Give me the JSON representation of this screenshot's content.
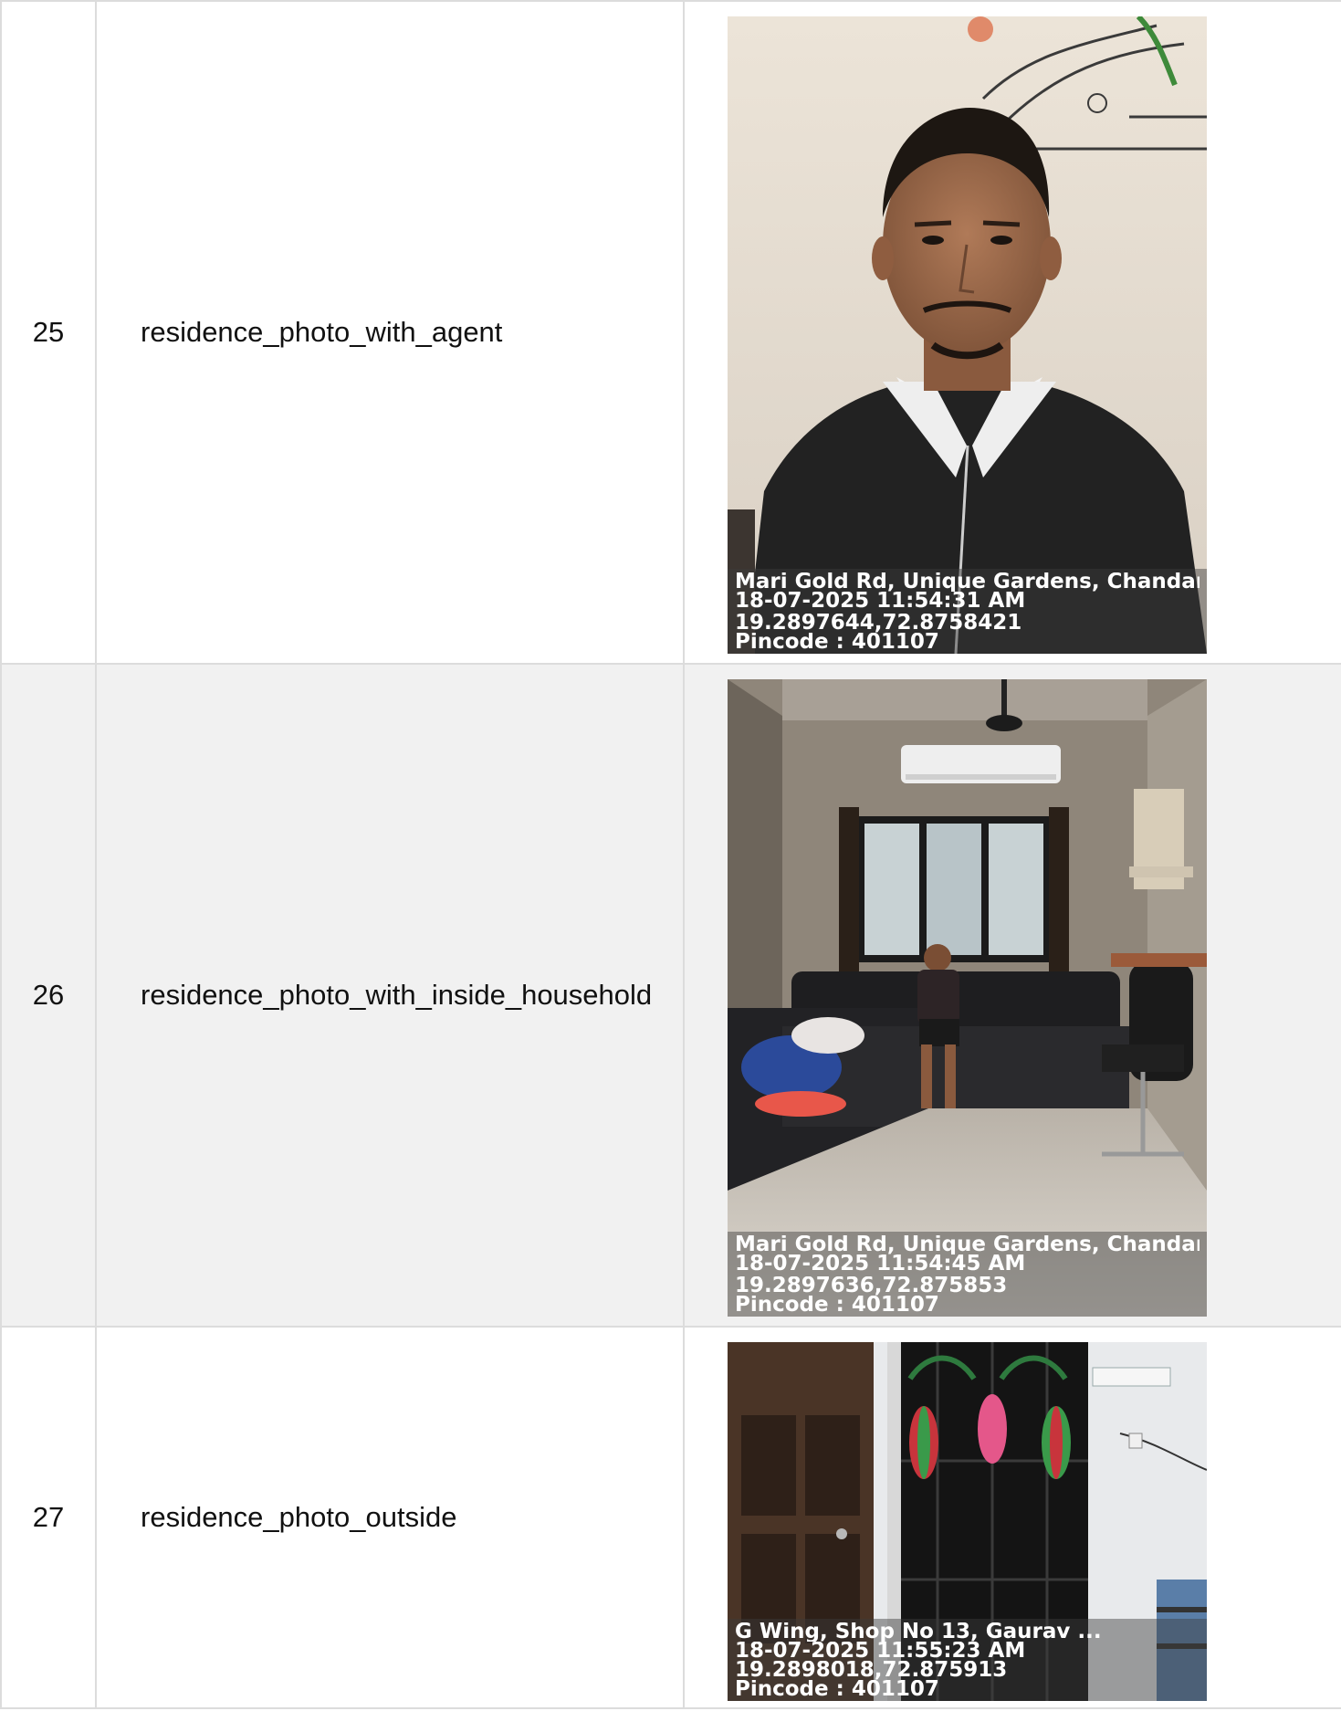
{
  "rows": [
    {
      "number": "25",
      "label": "residence_photo_with_agent",
      "photo": {
        "subject": "selfie of agent wearing black jacket with white collar",
        "stamp": {
          "address": "Mari Gold Rd, Unique Gardens, Chandan ...",
          "datetime": "18-07-2025 11:54:31 AM",
          "coordinates": "19.2897644,72.8758421",
          "pincode": "Pincode : 401107"
        }
      }
    },
    {
      "number": "26",
      "label": "residence_photo_with_inside_household",
      "photo": {
        "subject": "living room with man seated on black sofa",
        "stamp": {
          "address": "Mari Gold Rd, Unique Gardens, Chandan ...",
          "datetime": "18-07-2025 11:54:45 AM",
          "coordinates": "19.2897636,72.875853",
          "pincode": "Pincode : 401107"
        }
      }
    },
    {
      "number": "27",
      "label": "residence_photo_outside",
      "photo": {
        "subject": "black metal safety door beside brown door",
        "stamp": {
          "address": "G Wing, Shop No 13, Gaurav ...",
          "datetime": "18-07-2025 11:55:23 AM",
          "coordinates": "19.2898018,72.875913",
          "pincode": "Pincode : 401107"
        }
      }
    }
  ]
}
